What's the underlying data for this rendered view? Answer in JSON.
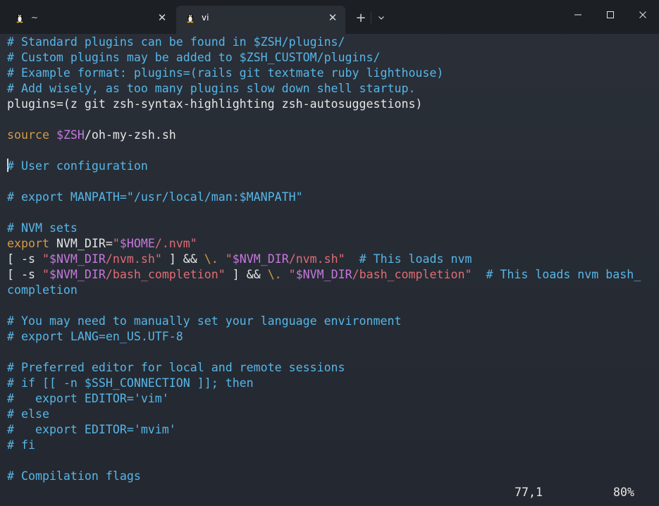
{
  "window": {
    "tabs": [
      {
        "title": "~",
        "close": "✕"
      },
      {
        "title": "vi",
        "close": "✕"
      }
    ],
    "new_tab": "+",
    "icons": {
      "tab": "linux-tux-icon",
      "dropdown": "chevron-down-icon",
      "minimize": "minimize-icon",
      "maximize": "maximize-icon",
      "close": "close-icon"
    }
  },
  "editor": {
    "lines": [
      {
        "segments": [
          {
            "t": "# Standard plugins can be found in $ZSH/plugins/",
            "k": "c"
          }
        ]
      },
      {
        "segments": [
          {
            "t": "# Custom plugins may be added to $ZSH_CUSTOM/plugins/",
            "k": "c"
          }
        ]
      },
      {
        "segments": [
          {
            "t": "# Example format: plugins=(rails git textmate ruby lighthouse)",
            "k": "c"
          }
        ]
      },
      {
        "segments": [
          {
            "t": "# Add wisely, as too many plugins slow down shell startup.",
            "k": "c"
          }
        ]
      },
      {
        "segments": [
          {
            "t": "plugins=(z git zsh-syntax-highlighting zsh-autosuggestions)",
            "k": "op"
          }
        ]
      },
      {
        "segments": []
      },
      {
        "segments": [
          {
            "t": "source",
            "k": "kw"
          },
          {
            "t": " ",
            "k": "op"
          },
          {
            "t": "$ZSH",
            "k": "var"
          },
          {
            "t": "/oh-my-zsh.sh",
            "k": "op"
          }
        ]
      },
      {
        "segments": []
      },
      {
        "cursor": true,
        "segments": [
          {
            "t": "# User configuration",
            "k": "c"
          }
        ]
      },
      {
        "segments": []
      },
      {
        "segments": [
          {
            "t": "# export MANPATH=\"/usr/local/man:$MANPATH\"",
            "k": "c"
          }
        ]
      },
      {
        "segments": []
      },
      {
        "segments": [
          {
            "t": "# NVM sets",
            "k": "c"
          }
        ]
      },
      {
        "segments": [
          {
            "t": "export",
            "k": "kw"
          },
          {
            "t": " NVM_DIR=",
            "k": "op"
          },
          {
            "t": "\"",
            "k": "str"
          },
          {
            "t": "$HOME",
            "k": "var"
          },
          {
            "t": "/.nvm\"",
            "k": "str"
          }
        ]
      },
      {
        "segments": [
          {
            "t": "[ -s ",
            "k": "op"
          },
          {
            "t": "\"",
            "k": "str"
          },
          {
            "t": "$NVM_DIR",
            "k": "var"
          },
          {
            "t": "/nvm.sh\"",
            "k": "str"
          },
          {
            "t": " ] && ",
            "k": "op"
          },
          {
            "t": "\\.",
            "k": "kw"
          },
          {
            "t": " ",
            "k": "op"
          },
          {
            "t": "\"",
            "k": "str"
          },
          {
            "t": "$NVM_DIR",
            "k": "var"
          },
          {
            "t": "/nvm.sh\"",
            "k": "str"
          },
          {
            "t": "  ",
            "k": "op"
          },
          {
            "t": "# This loads nvm",
            "k": "c"
          }
        ]
      },
      {
        "segments": [
          {
            "t": "[ -s ",
            "k": "op"
          },
          {
            "t": "\"",
            "k": "str"
          },
          {
            "t": "$NVM_DIR",
            "k": "var"
          },
          {
            "t": "/bash_completion\"",
            "k": "str"
          },
          {
            "t": " ] && ",
            "k": "op"
          },
          {
            "t": "\\.",
            "k": "kw"
          },
          {
            "t": " ",
            "k": "op"
          },
          {
            "t": "\"",
            "k": "str"
          },
          {
            "t": "$NVM_DIR",
            "k": "var"
          },
          {
            "t": "/bash_completion\"",
            "k": "str"
          },
          {
            "t": "  ",
            "k": "op"
          },
          {
            "t": "# This loads nvm bash_",
            "k": "c"
          }
        ]
      },
      {
        "segments": [
          {
            "t": "completion",
            "k": "c"
          }
        ]
      },
      {
        "segments": []
      },
      {
        "segments": [
          {
            "t": "# You may need to manually set your language environment",
            "k": "c"
          }
        ]
      },
      {
        "segments": [
          {
            "t": "# export LANG=en_US.UTF-8",
            "k": "c"
          }
        ]
      },
      {
        "segments": []
      },
      {
        "segments": [
          {
            "t": "# Preferred editor for local and remote sessions",
            "k": "c"
          }
        ]
      },
      {
        "segments": [
          {
            "t": "# if [[ -n $SSH_CONNECTION ]]; then",
            "k": "c"
          }
        ]
      },
      {
        "segments": [
          {
            "t": "#   export EDITOR='vim'",
            "k": "c"
          }
        ]
      },
      {
        "segments": [
          {
            "t": "# else",
            "k": "c"
          }
        ]
      },
      {
        "segments": [
          {
            "t": "#   export EDITOR='mvim'",
            "k": "c"
          }
        ]
      },
      {
        "segments": [
          {
            "t": "# fi",
            "k": "c"
          }
        ]
      },
      {
        "segments": []
      },
      {
        "segments": [
          {
            "t": "# Compilation flags",
            "k": "c"
          }
        ]
      }
    ]
  },
  "status": {
    "position": "77,1",
    "percent": "80%"
  },
  "colors": {
    "comment": "#56b6e8",
    "keyword": "#d39b45",
    "variable": "#c678dd",
    "string": "#e06c75",
    "text": "#e6e6e6",
    "background": "#262b33",
    "titlebar": "#1c1f24"
  }
}
